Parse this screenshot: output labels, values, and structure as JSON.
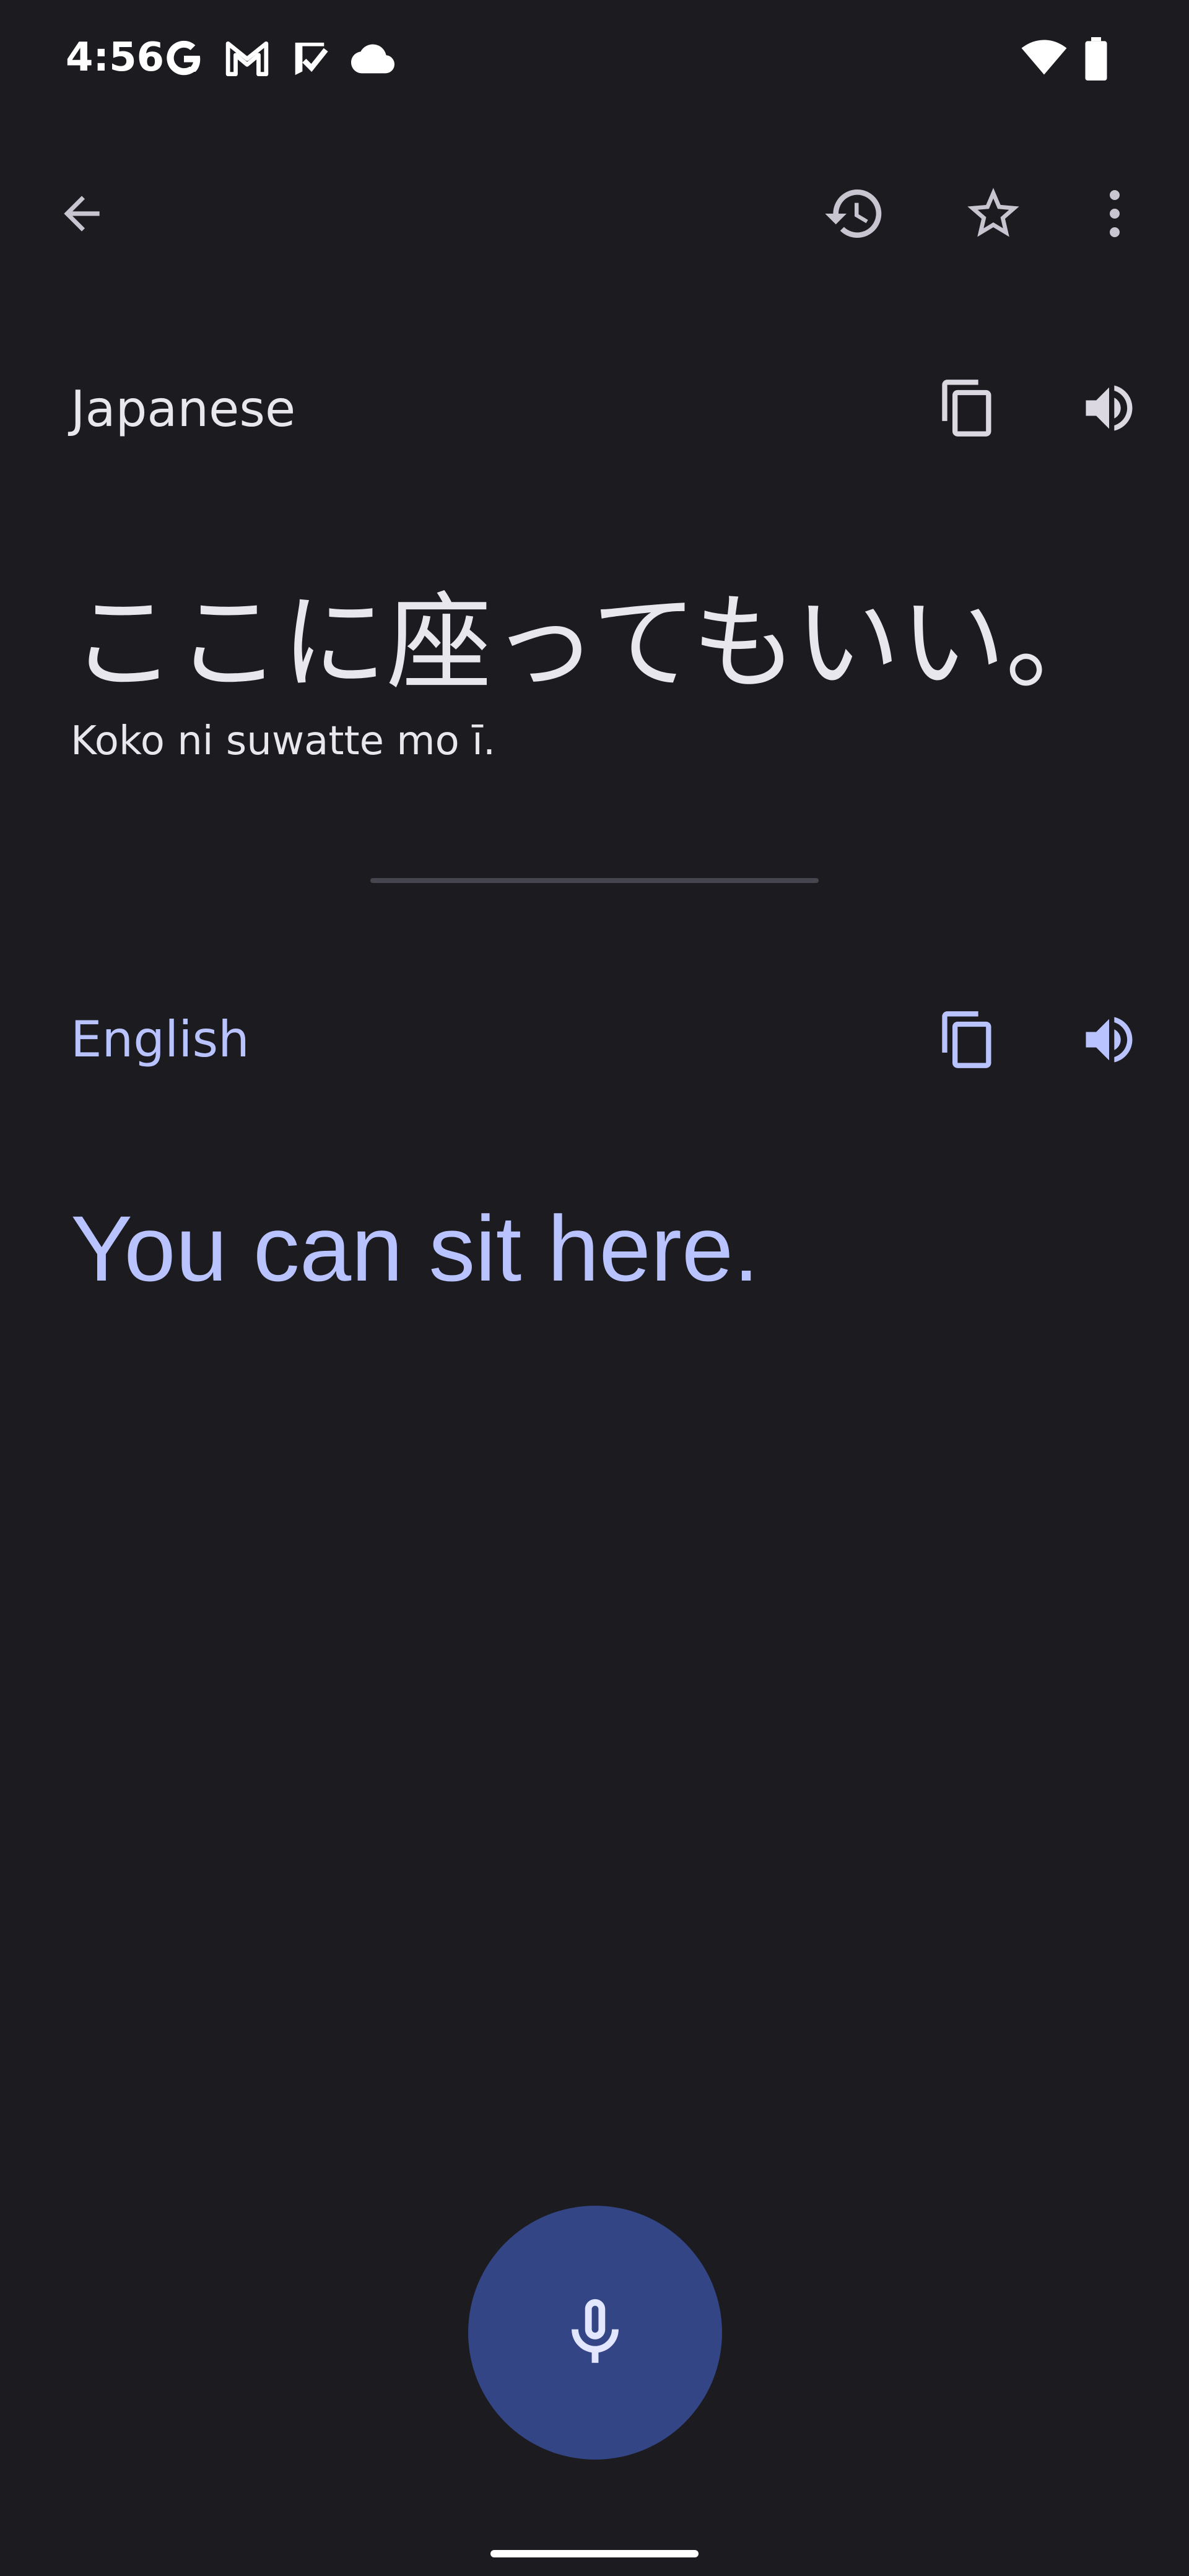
{
  "status": {
    "time": "4:56",
    "icons": [
      "google-g-icon",
      "gmail-icon",
      "tasks-icon",
      "cloud-icon",
      "wifi-icon",
      "battery-icon"
    ]
  },
  "app_bar": {
    "icons": [
      "back-arrow-icon",
      "history-icon",
      "star-icon",
      "more-vert-icon"
    ]
  },
  "source": {
    "language": "Japanese",
    "text": "ここに座ってもいい。",
    "romanization": "Koko ni suwatte mo ī."
  },
  "target": {
    "language": "English",
    "text": "You can sit here."
  },
  "colors": {
    "background": "#1c1b20",
    "source_text": "#e9e7ee",
    "target_accent": "#b9c3ff",
    "mic_fab": "#334585",
    "divider": "#46464f"
  }
}
